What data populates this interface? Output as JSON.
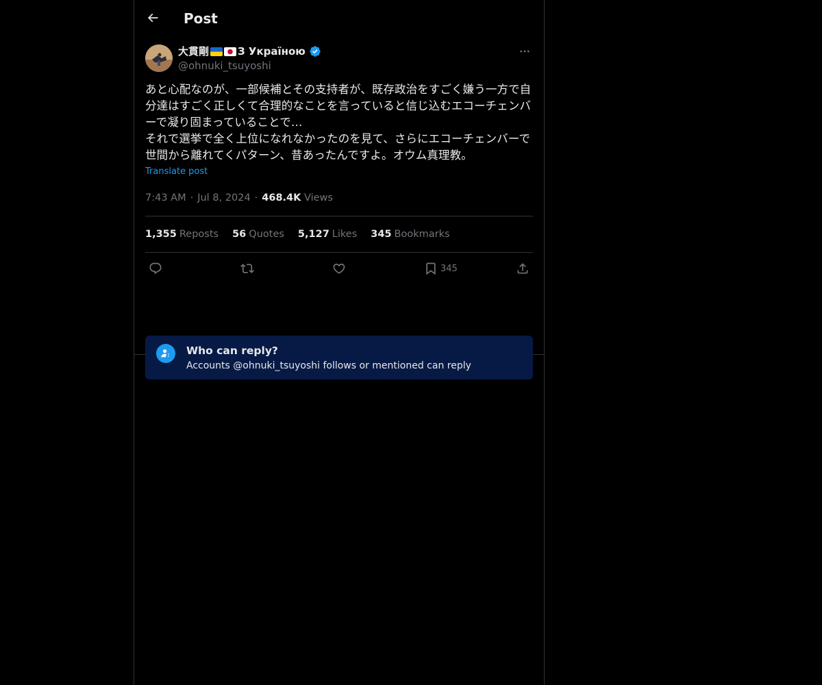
{
  "header": {
    "title": "Post",
    "back_icon": "arrow-left-icon"
  },
  "author": {
    "display_name": "大貫剛",
    "display_suffix": "З Україною",
    "flags": [
      "ukraine-flag",
      "japan-flag"
    ],
    "verified": true,
    "handle": "@ohnuki_tsuyoshi"
  },
  "post": {
    "text": "あと心配なのが、一部候補とその支持者が、既存政治をすごく嫌う一方で自分達はすごく正しくて合理的なことを言っていると信じ込むエコーチェンバーで凝り固まっていることで…\nそれで選挙で全く上位になれなかったのを見て、さらにエコーチェンバーで世間から離れてくパターン、昔あったんですよ。オウム真理教。",
    "translate_label": "Translate post",
    "time": "7:43 AM",
    "date": "Jul 8, 2024",
    "views_count": "468.4K",
    "views_label": "Views"
  },
  "stats": [
    {
      "count": "1,355",
      "label": "Reposts"
    },
    {
      "count": "56",
      "label": "Quotes"
    },
    {
      "count": "5,127",
      "label": "Likes"
    },
    {
      "count": "345",
      "label": "Bookmarks"
    }
  ],
  "actions": {
    "bookmark_count": "345"
  },
  "reply_info": {
    "title": "Who can reply?",
    "subtitle": "Accounts @ohnuki_tsuyoshi follows or mentioned can reply"
  },
  "colors": {
    "background": "#000000",
    "text": "#e7e9ea",
    "muted": "#71767b",
    "accent": "#1d9bf0",
    "reply_box": "#071a46"
  }
}
